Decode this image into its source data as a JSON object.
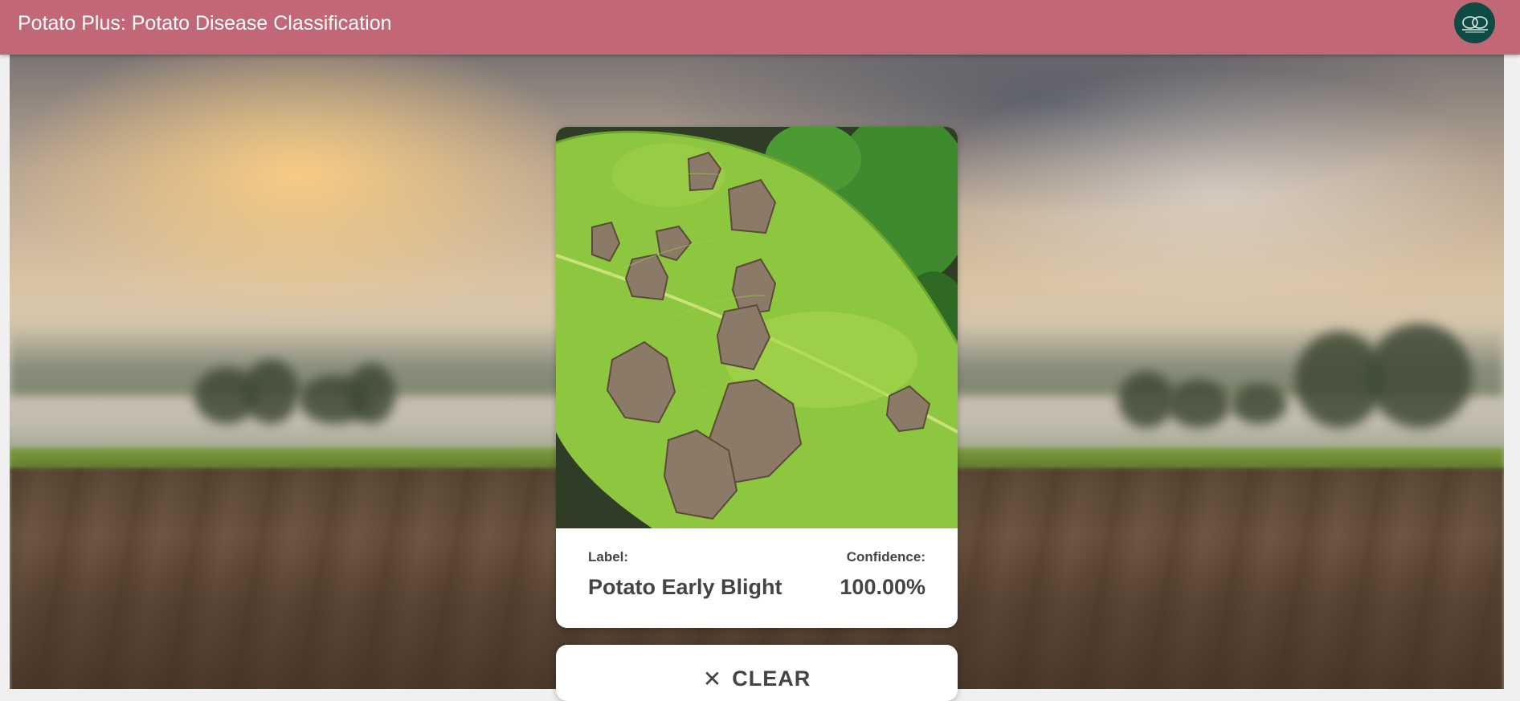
{
  "app": {
    "title": "Potato Plus: Potato Disease Classification",
    "logo_icon": "potato-logo-icon",
    "colors": {
      "appbar": "#c16776",
      "logo_bg": "#0f4b45",
      "text_dark": "#444444"
    }
  },
  "result": {
    "label_caption": "Label:",
    "label_value": "Potato Early Blight",
    "confidence_caption": "Confidence:",
    "confidence_value": "100.00%",
    "image_icon": "potato-leaf-early-blight-image"
  },
  "actions": {
    "clear_label": "CLEAR",
    "clear_icon": "close-icon"
  }
}
